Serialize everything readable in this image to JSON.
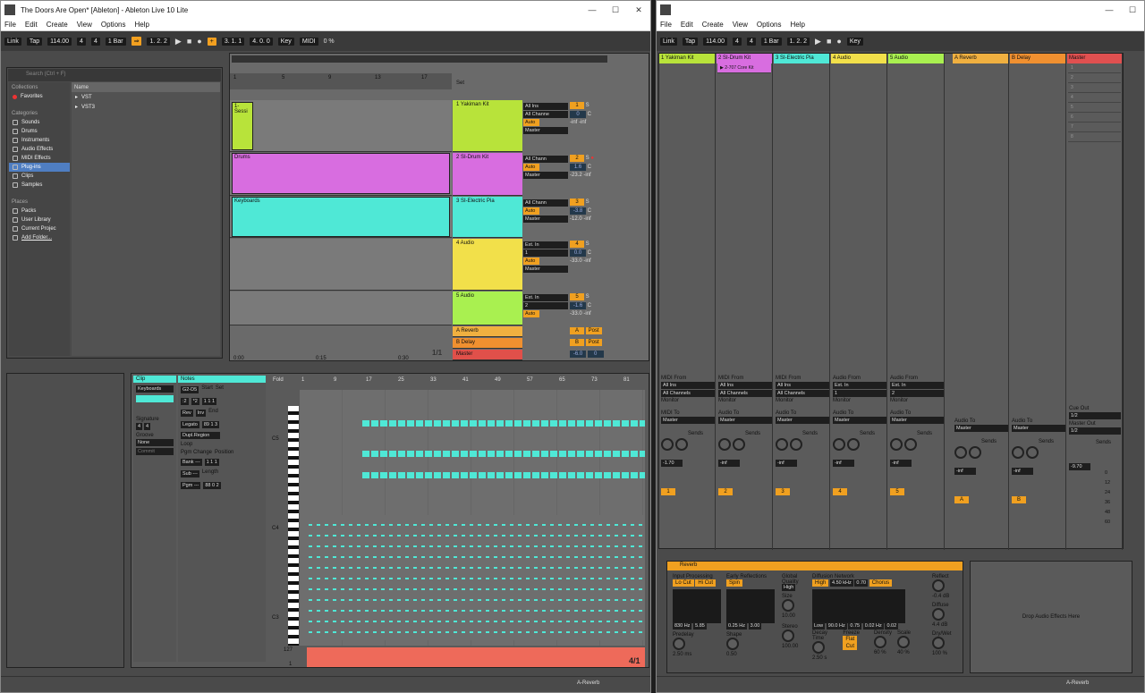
{
  "left_window": {
    "title": "The Doors Are Open*  [Ableton] - Ableton Live 10 Lite",
    "menu": [
      "File",
      "Edit",
      "Create",
      "View",
      "Options",
      "Help"
    ],
    "transport": {
      "link": "Link",
      "tap": "Tap",
      "tempo": "114.00",
      "sig_num": "4",
      "sig_den": "4",
      "quantize": "1 Bar",
      "position": "1.   2.   2",
      "loop_start": "3.   1.   1",
      "loop_len": "4.   0.   0",
      "key": "Key",
      "midi": "MIDI",
      "cpu": "0 %"
    },
    "browser": {
      "search_placeholder": "Search (Ctrl + F)",
      "collections_label": "Collections",
      "favorites": "Favorites",
      "categories_label": "Categories",
      "categories": [
        "Sounds",
        "Drums",
        "Instruments",
        "Audio Effects",
        "MIDI Effects",
        "Plug-ins",
        "Clips",
        "Samples"
      ],
      "places_label": "Places",
      "places": [
        "Packs",
        "User Library",
        "Current Projec",
        "Add Folder..."
      ],
      "name_header": "Name",
      "items": [
        "VST",
        "VST3"
      ]
    },
    "arrangement": {
      "ruler": [
        "1",
        "5",
        "9",
        "13",
        "17"
      ],
      "time": [
        "0:00",
        "0:15",
        "0:30"
      ],
      "set_label": "Set",
      "fraction": "1/1",
      "tracks": [
        {
          "name": "1 Yakiman Kit",
          "clip": "1-Sessi",
          "input": "All Ins",
          "channel": "All Channe",
          "num": "1",
          "vol": "0",
          "vol2": "-inf",
          "vol3": "-inf",
          "pan": "C",
          "color": "#b8e33a"
        },
        {
          "name": "2 SI-Drum Kit",
          "clip": "Drums",
          "input": "All Chann",
          "channel": "",
          "num": "2",
          "vol": "1.6",
          "vol2": "-23.2",
          "vol3": "-inf",
          "pan": "C",
          "color": "#d86de0"
        },
        {
          "name": "3 SI-Electric Pia",
          "clip": "Keyboards",
          "input": "All Chann",
          "channel": "",
          "num": "3",
          "vol": "-3.8",
          "vol2": "-12.0",
          "vol3": "-inf",
          "pan": "C",
          "color": "#4fe8d6"
        },
        {
          "name": "4 Audio",
          "clip": "",
          "input": "Ext. In",
          "channel": "1",
          "num": "4",
          "vol": "0.0",
          "vol2": "-33.0",
          "vol3": "-inf",
          "pan": "C",
          "color": "#f2e04a"
        },
        {
          "name": "5 Audio",
          "clip": "",
          "input": "Ext. In",
          "channel": "2",
          "num": "5",
          "vol": "-1.6",
          "vol2": "-33.0",
          "vol3": "-inf",
          "pan": "C",
          "color": "#a9f050"
        }
      ],
      "returns": [
        {
          "name": "A Reverb",
          "num": "A",
          "post": "Post",
          "color": "#f0b040"
        },
        {
          "name": "B Delay",
          "num": "B",
          "post": "Post",
          "color": "#f09030"
        },
        {
          "name": "Master",
          "num": "1/2",
          "vol": "-6.0",
          "vol2": "0",
          "color": "#e0504a"
        }
      ],
      "master_label": "Master",
      "in_label": "In",
      "auto_label": "Auto",
      "off_label": "Off",
      "s_label": "S"
    },
    "clipview": {
      "clip_label": "Clip",
      "notes_label": "Notes",
      "clip_name": "Keyboards",
      "range": "G2-D5",
      "start_label": "Start",
      "set": "Set",
      "start": "1    1    1",
      "end_label": "End",
      "end": "89    1    3",
      "rev": "Rev",
      "inv": "Inv",
      "legato": "Legato",
      "dupl": "Dupl.Region",
      "loop": "Loop",
      "position_label": "Position",
      "position": "1    1    1",
      "length_label": "Length",
      "length": "88    0    2",
      "signature_label": "Signature",
      "sig_num": "4",
      "sig_den": "4",
      "groove_label": "Groove",
      "groove": "None",
      "commit": "Commit",
      "pgm_label": "Pgm Change",
      "bank": "Bank ---",
      "sub": "Sub ---",
      "pgm": "Pgm ---",
      "half": ":2",
      "double": "*2",
      "fold": "Fold",
      "ruler": [
        "1",
        "9",
        "17",
        "25",
        "33",
        "41",
        "49",
        "57",
        "65",
        "73",
        "81"
      ],
      "octaves": [
        "C5",
        "C4",
        "C3"
      ],
      "vel_max": "127",
      "vel_min": "1",
      "fraction": "4/1"
    },
    "status": "A-Reverb"
  },
  "right_window": {
    "menu": [
      "File",
      "Edit",
      "Create",
      "View",
      "Options",
      "Help"
    ],
    "transport": {
      "link": "Link",
      "tap": "Tap",
      "tempo": "114.00",
      "sig_num": "4",
      "sig_den": "4",
      "quantize": "1 Bar",
      "position": "1.   2.   2",
      "key": "Key"
    },
    "columns": [
      {
        "name": "1 Yakiman Kit",
        "color": "#b8e33a",
        "clip": "",
        "from": "MIDI From",
        "input": "All Ins",
        "chan": "All Channels",
        "to": "MIDI To",
        "out": "Master",
        "vol": "-1.70",
        "num": "1"
      },
      {
        "name": "2 SI-Drum Kit",
        "color": "#d86de0",
        "clip": "2-707 Core Kit",
        "from": "MIDI From",
        "input": "All Ins",
        "chan": "All Channels",
        "to": "Audio To",
        "out": "Master",
        "vol": "-inf",
        "num": "2"
      },
      {
        "name": "3 SI-Electric Pia",
        "color": "#4fe8d6",
        "clip": "",
        "from": "MIDI From",
        "input": "All Ins",
        "chan": "All Channels",
        "to": "Audio To",
        "out": "Master",
        "vol": "-inf",
        "num": "3"
      },
      {
        "name": "4 Audio",
        "color": "#f2e04a",
        "clip": "",
        "from": "Audio From",
        "input": "Ext. In",
        "chan": "1",
        "to": "Audio To",
        "out": "Master",
        "vol": "-inf",
        "num": "4"
      },
      {
        "name": "5 Audio",
        "color": "#a9f050",
        "clip": "",
        "from": "Audio From",
        "input": "Ext. In",
        "chan": "2",
        "to": "Audio To",
        "out": "Master",
        "vol": "-inf",
        "num": "5"
      },
      {
        "name": "A Reverb",
        "color": "#f0b040",
        "clip": "",
        "from": "",
        "input": "",
        "chan": "",
        "to": "Audio To",
        "out": "Master",
        "vol": "-inf",
        "num": "A"
      },
      {
        "name": "B Delay",
        "color": "#f09030",
        "clip": "",
        "from": "",
        "input": "",
        "chan": "",
        "to": "Audio To",
        "out": "Master",
        "vol": "-inf",
        "num": "B"
      },
      {
        "name": "Master",
        "color": "#e05050",
        "clip": "",
        "from": "",
        "input": "",
        "chan": "",
        "to": "Master Out",
        "out": "1/2",
        "vol": "-9.70",
        "num": ""
      }
    ],
    "scenes": [
      "1",
      "2",
      "3",
      "4",
      "5",
      "6",
      "7",
      "8"
    ],
    "monitor_label": "Monitor",
    "sends_label": "Sends",
    "cue_label": "Cue Out",
    "cue_val": "1/2",
    "db_scale": [
      "0",
      "12",
      "24",
      "36",
      "48",
      "60"
    ],
    "device": {
      "name": "Reverb",
      "input_proc": "Input Processing",
      "lo_cut": "Lo Cut",
      "hi_cut": "Hi Cut",
      "early": "Early Reflections",
      "spin": "Spin",
      "global": "Global",
      "quality": "Quality",
      "quality_val": "High",
      "size": "Size",
      "size_val": "10.00",
      "diffusion": "Diffusion Network",
      "high": "High",
      "freq": "4.50 kHz",
      "q": "0.70",
      "chorus": "Chorus",
      "reflect": "Reflect",
      "reflect_val": "-0.4 dB",
      "diffuse": "Diffuse",
      "diffuse_val": "4.4 dB",
      "f1": "830 Hz",
      "f2": "5.85",
      "f3": "0.25 Hz",
      "f4": "3.00",
      "low": "Low",
      "f5": "90.0 Hz",
      "f6": "0.75",
      "f7": "0.02 Hz",
      "f8": "0.02",
      "predelay": "Predelay",
      "predelay_val": "2.50 ms",
      "shape": "Shape",
      "shape_val": "0.50",
      "stereo": "Stereo",
      "stereo_val": "100.00",
      "decay": "Decay Time",
      "decay_val": "2.50 s",
      "freeze": "Freeze",
      "flat": "Flat",
      "cut": "Cut",
      "density": "Density",
      "density_val": "60 %",
      "scale": "Scale",
      "scale_val": "40 %",
      "drywet": "Dry/Wet",
      "drywet_val": "100 %"
    },
    "drop_text": "Drop Audio Effects Here",
    "status": "A-Reverb"
  }
}
